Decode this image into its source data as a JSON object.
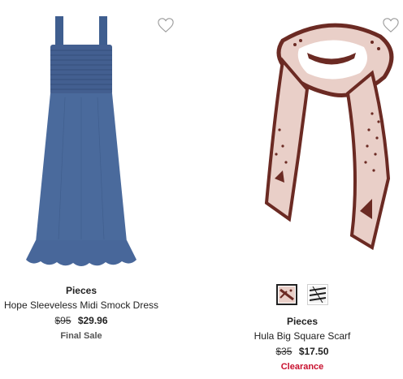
{
  "products": [
    {
      "brand": "Pieces",
      "name": "Hope Sleeveless Midi Smock Dress",
      "original_price": "$95",
      "sale_price": "$29.96",
      "tag": "Final Sale",
      "image_icon": "denim-dress",
      "dress_color": "#4a6a9c"
    },
    {
      "brand": "Pieces",
      "name": "Hula Big Square Scarf",
      "original_price": "$35",
      "sale_price": "$17.50",
      "tag": "Clearance",
      "tag_color": "#c8102e",
      "image_icon": "patterned-scarf",
      "scarf_base_color": "#e9cfc8",
      "scarf_pattern_color": "#6b2a23",
      "swatches": [
        {
          "icon": "pink-brown-swatch",
          "selected": true
        },
        {
          "icon": "black-white-swatch",
          "selected": false
        }
      ]
    }
  ]
}
